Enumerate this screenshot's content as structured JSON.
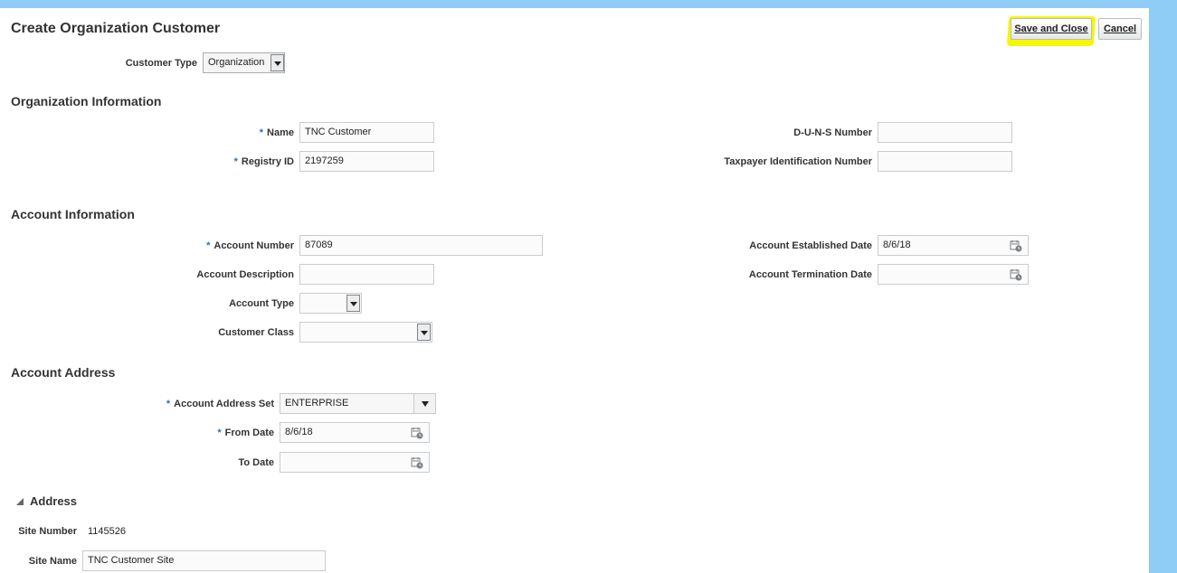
{
  "header": {
    "title": "Create Organization Customer",
    "save_close_label": "Save and Close",
    "save_close_accel": "S",
    "save_close_rest": "ave and Close",
    "cancel_label": "Cancel",
    "cancel_accel": "C",
    "cancel_rest": "ancel"
  },
  "customer_type": {
    "label": "Customer Type",
    "value": "Organization"
  },
  "organization_info": {
    "title": "Organization Information",
    "name": {
      "label": "Name",
      "value": "TNC Customer",
      "required": "*"
    },
    "registry_id": {
      "label": "Registry ID",
      "value": "2197259",
      "required": "*"
    },
    "duns": {
      "label": "D-U-N-S Number",
      "value": ""
    },
    "taxpayer_id": {
      "label": "Taxpayer Identification Number",
      "value": ""
    }
  },
  "account_info": {
    "title": "Account Information",
    "account_number": {
      "label": "Account Number",
      "value": "87089",
      "required": "*"
    },
    "account_description": {
      "label": "Account Description",
      "value": ""
    },
    "account_type": {
      "label": "Account Type",
      "value": ""
    },
    "customer_class": {
      "label": "Customer Class",
      "value": ""
    },
    "established_date": {
      "label": "Account Established Date",
      "value": "8/6/18"
    },
    "termination_date": {
      "label": "Account Termination Date",
      "value": ""
    }
  },
  "account_address": {
    "title": "Account Address",
    "address_set": {
      "label": "Account Address Set",
      "value": "ENTERPRISE",
      "required": "*"
    },
    "from_date": {
      "label": "From Date",
      "value": "8/6/18",
      "required": "*"
    },
    "to_date": {
      "label": "To Date",
      "value": ""
    }
  },
  "address": {
    "title": "Address",
    "site_number": {
      "label": "Site Number",
      "value": "1145526"
    },
    "site_name": {
      "label": "Site Name",
      "value": "TNC Customer Site"
    }
  },
  "colors": {
    "page_background": "#8fcdf6",
    "highlight": "#f6f606",
    "required_asterisk": "#2e6fb8"
  },
  "icons": [
    "calendar-icon",
    "dropdown-arrow-icon",
    "collapse-triangle-icon"
  ]
}
